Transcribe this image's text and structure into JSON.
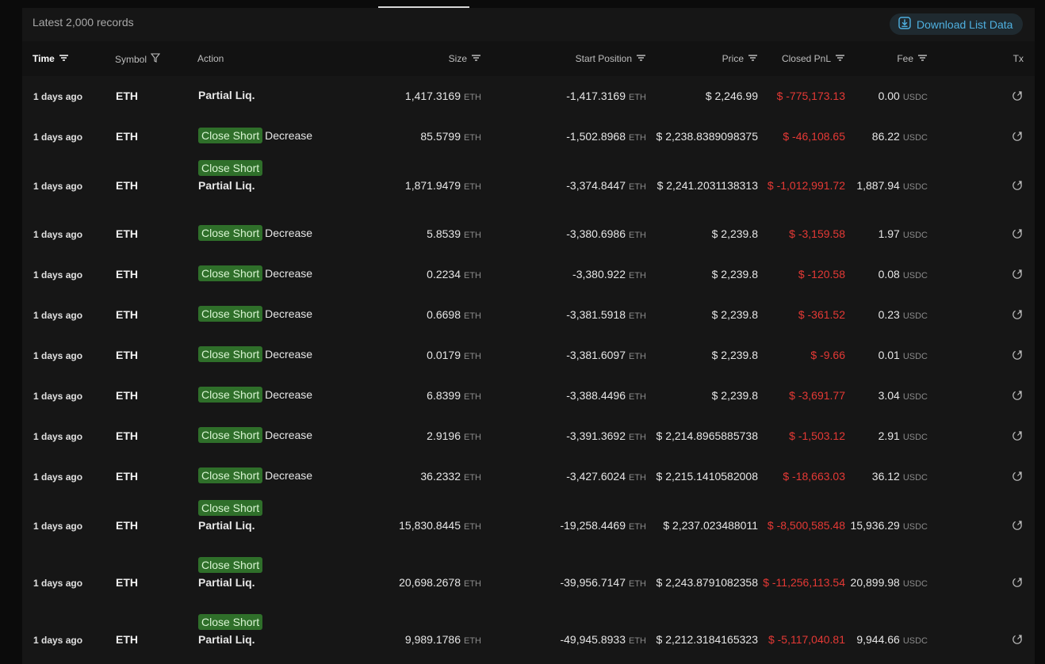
{
  "records_label": "Latest 2,000 records",
  "download_label": "Download List Data",
  "columns": {
    "time": "Time",
    "symbol": "Symbol",
    "action": "Action",
    "size": "Size",
    "start_position": "Start Position",
    "price": "Price",
    "closed_pnl": "Closed PnL",
    "fee": "Fee",
    "tx": "Tx"
  },
  "units": {
    "eth": "ETH",
    "usdc": "USDC"
  },
  "colors": {
    "accent": "#4fb0e0",
    "badge": "#2f6f2a",
    "negative": "#e53935"
  },
  "rows": [
    {
      "time": "1 days ago",
      "symbol": "ETH",
      "badge": "",
      "action": "Partial Liq.",
      "size": "1,417.3169",
      "start": "-1,417.3169",
      "price": "$ 2,246.99",
      "pnl": "$ -775,173.13",
      "fee": "0.00"
    },
    {
      "time": "1 days ago",
      "symbol": "ETH",
      "badge": "Close Short",
      "action": "Decrease",
      "size": "85.5799",
      "start": "-1,502.8968",
      "price": "$ 2,238.8389098375",
      "pnl": "$ -46,108.65",
      "fee": "86.22"
    },
    {
      "time": "1 days ago",
      "symbol": "ETH",
      "badge": "Close Short",
      "action": "Partial Liq.",
      "size": "1,871.9479",
      "start": "-3,374.8447",
      "price": "$ 2,241.2031138313",
      "pnl": "$ -1,012,991.72",
      "fee": "1,887.94"
    },
    {
      "time": "1 days ago",
      "symbol": "ETH",
      "badge": "Close Short",
      "action": "Decrease",
      "size": "5.8539",
      "start": "-3,380.6986",
      "price": "$ 2,239.8",
      "pnl": "$ -3,159.58",
      "fee": "1.97"
    },
    {
      "time": "1 days ago",
      "symbol": "ETH",
      "badge": "Close Short",
      "action": "Decrease",
      "size": "0.2234",
      "start": "-3,380.922",
      "price": "$ 2,239.8",
      "pnl": "$ -120.58",
      "fee": "0.08"
    },
    {
      "time": "1 days ago",
      "symbol": "ETH",
      "badge": "Close Short",
      "action": "Decrease",
      "size": "0.6698",
      "start": "-3,381.5918",
      "price": "$ 2,239.8",
      "pnl": "$ -361.52",
      "fee": "0.23"
    },
    {
      "time": "1 days ago",
      "symbol": "ETH",
      "badge": "Close Short",
      "action": "Decrease",
      "size": "0.0179",
      "start": "-3,381.6097",
      "price": "$ 2,239.8",
      "pnl": "$ -9.66",
      "fee": "0.01"
    },
    {
      "time": "1 days ago",
      "symbol": "ETH",
      "badge": "Close Short",
      "action": "Decrease",
      "size": "6.8399",
      "start": "-3,388.4496",
      "price": "$ 2,239.8",
      "pnl": "$ -3,691.77",
      "fee": "3.04"
    },
    {
      "time": "1 days ago",
      "symbol": "ETH",
      "badge": "Close Short",
      "action": "Decrease",
      "size": "2.9196",
      "start": "-3,391.3692",
      "price": "$ 2,214.8965885738",
      "pnl": "$ -1,503.12",
      "fee": "2.91"
    },
    {
      "time": "1 days ago",
      "symbol": "ETH",
      "badge": "Close Short",
      "action": "Decrease",
      "size": "36.2332",
      "start": "-3,427.6024",
      "price": "$ 2,215.1410582008",
      "pnl": "$ -18,663.03",
      "fee": "36.12"
    },
    {
      "time": "1 days ago",
      "symbol": "ETH",
      "badge": "Close Short",
      "action": "Partial Liq.",
      "size": "15,830.8445",
      "start": "-19,258.4469",
      "price": "$ 2,237.023488011",
      "pnl": "$ -8,500,585.48",
      "fee": "15,936.29"
    },
    {
      "time": "1 days ago",
      "symbol": "ETH",
      "badge": "Close Short",
      "action": "Partial Liq.",
      "size": "20,698.2678",
      "start": "-39,956.7147",
      "price": "$ 2,243.8791082358",
      "pnl": "$ -11,256,113.54",
      "fee": "20,899.98"
    },
    {
      "time": "1 days ago",
      "symbol": "ETH",
      "badge": "Close Short",
      "action": "Partial Liq.",
      "size": "9,989.1786",
      "start": "-49,945.8933",
      "price": "$ 2,212.3184165323",
      "pnl": "$ -5,117,040.81",
      "fee": "9,944.66"
    }
  ]
}
